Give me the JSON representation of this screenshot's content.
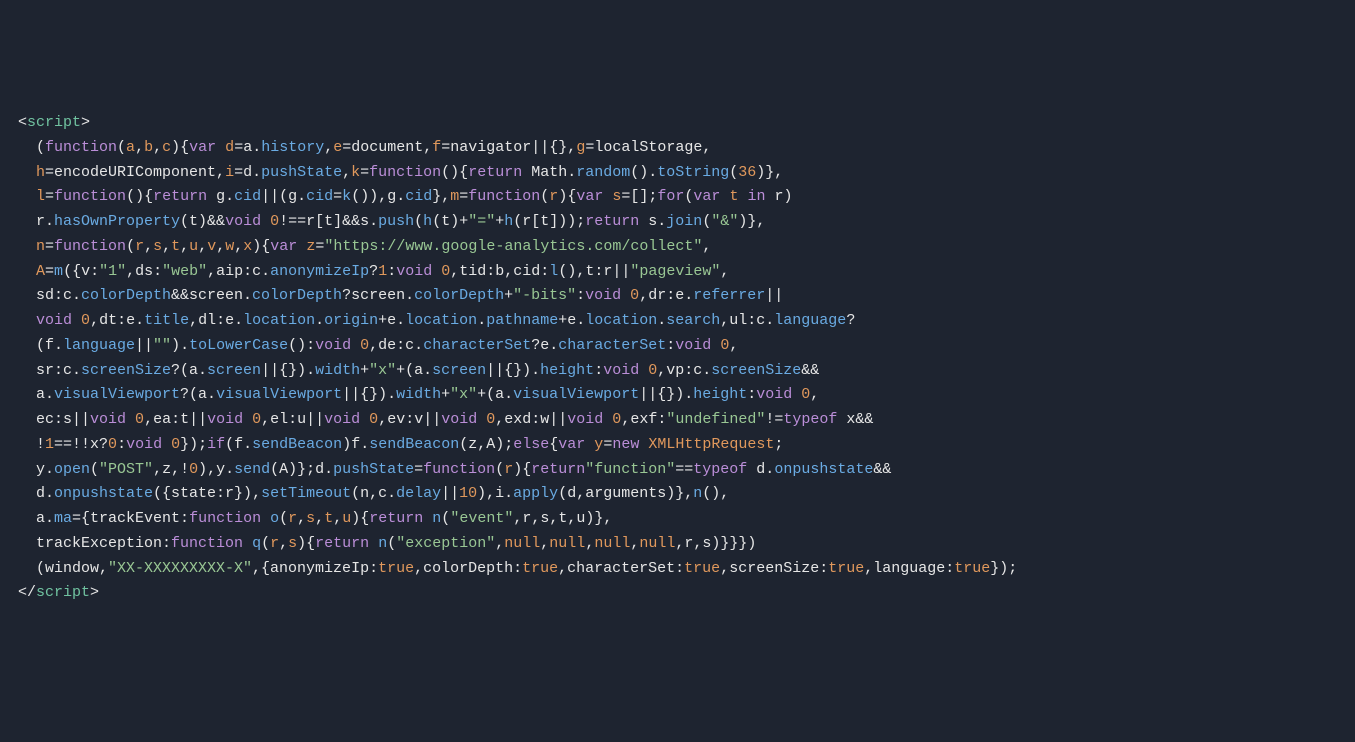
{
  "code": {
    "lines": [
      "<script>",
      "  (function(a,b,c){var d=a.history,e=document,f=navigator||{},g=localStorage,",
      "  h=encodeURIComponent,i=d.pushState,k=function(){return Math.random().toString(36)},",
      "  l=function(){return g.cid||(g.cid=k()),g.cid},m=function(r){var s=[];for(var t in r)",
      "  r.hasOwnProperty(t)&&void 0!==r[t]&&s.push(h(t)+\"=\"+h(r[t]));return s.join(\"&\")},",
      "  n=function(r,s,t,u,v,w,x){var z=\"https://www.google-analytics.com/collect\",",
      "  A=m({v:\"1\",ds:\"web\",aip:c.anonymizeIp?1:void 0,tid:b,cid:l(),t:r||\"pageview\",",
      "  sd:c.colorDepth&&screen.colorDepth?screen.colorDepth+\"-bits\":void 0,dr:e.referrer||",
      "  void 0,dt:e.title,dl:e.location.origin+e.location.pathname+e.location.search,ul:c.language?",
      "  (f.language||\"\").toLowerCase():void 0,de:c.characterSet?e.characterSet:void 0,",
      "  sr:c.screenSize?(a.screen||{}).width+\"x\"+(a.screen||{}).height:void 0,vp:c.screenSize&&",
      "  a.visualViewport?(a.visualViewport||{}).width+\"x\"+(a.visualViewport||{}).height:void 0,",
      "  ec:s||void 0,ea:t||void 0,el:u||void 0,ev:v||void 0,exd:w||void 0,exf:\"undefined\"!=typeof x&&",
      "  !1==!!x?0:void 0});if(f.sendBeacon)f.sendBeacon(z,A);else{var y=new XMLHttpRequest;",
      "  y.open(\"POST\",z,!0),y.send(A)};d.pushState=function(r){return\"function\"==typeof d.onpushstate&&",
      "  d.onpushstate({state:r}),setTimeout(n,c.delay||10),i.apply(d,arguments)},n(),",
      "  a.ma={trackEvent:function o(r,s,t,u){return n(\"event\",r,s,t,u)},",
      "  trackException:function q(r,s){return n(\"exception\",null,null,null,null,r,s)}}})",
      "  (window,\"XX-XXXXXXXXX-X\",{anonymizeIp:true,colorDepth:true,characterSet:true,screenSize:true,language:true});",
      "</script>"
    ]
  }
}
